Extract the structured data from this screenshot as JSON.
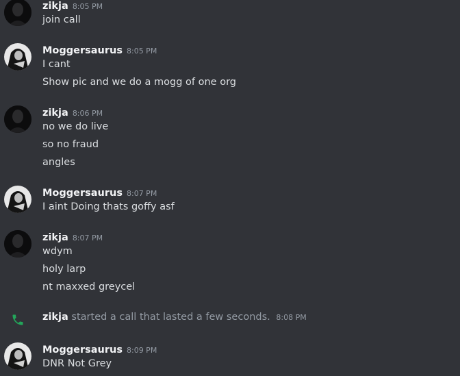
{
  "messages": [
    {
      "author": "zikja",
      "time": "8:05 PM",
      "lines": [
        "join call"
      ]
    },
    {
      "author": "Moggersaurus",
      "time": "8:05 PM",
      "lines": [
        "I cant",
        "Show pic and we do a mogg of one org"
      ]
    },
    {
      "author": "zikja",
      "time": "8:06 PM",
      "lines": [
        "no we do live",
        "so no fraud",
        "angles"
      ]
    },
    {
      "author": "Moggersaurus",
      "time": "8:07 PM",
      "lines": [
        "I aint Doing thats goffy asf"
      ]
    },
    {
      "author": "zikja",
      "time": "8:07 PM",
      "lines": [
        "wdym",
        "holy larp",
        "nt maxxed greycel"
      ]
    },
    {
      "author": "Moggersaurus",
      "time": "8:09 PM",
      "lines": [
        "DNR Not Grey"
      ]
    }
  ],
  "call_event": {
    "author": "zikja",
    "text": "started a call that lasted a few seconds.",
    "time": "8:08 PM",
    "icon": "phone-icon",
    "icon_color": "#23a55a"
  },
  "colors": {
    "background": "#313338",
    "username": "#f2f3f5",
    "message_text": "#dbdee1",
    "muted": "#949ba4"
  }
}
